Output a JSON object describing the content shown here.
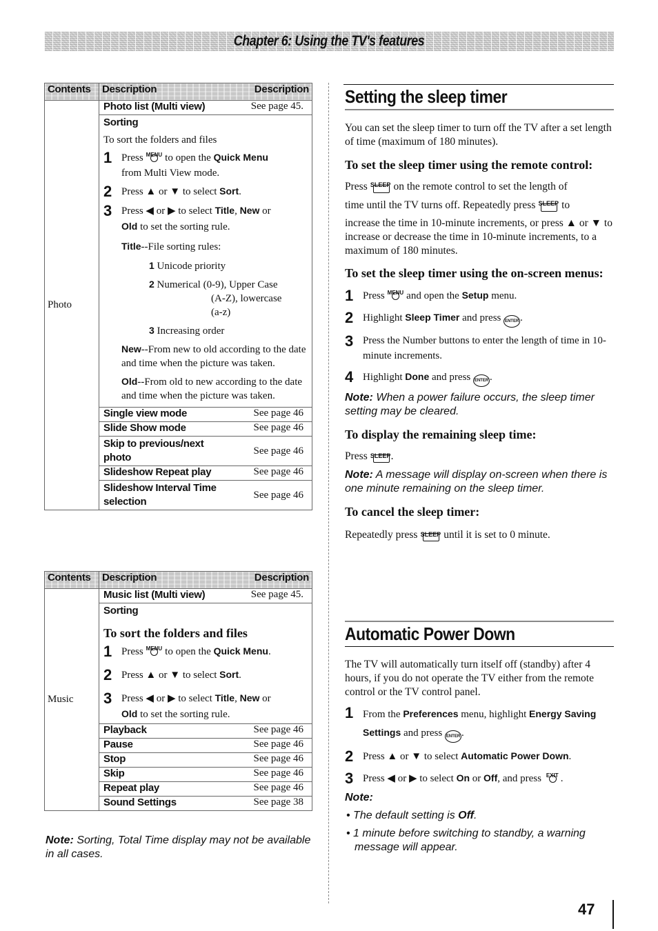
{
  "chapter_title": "Chapter 6: Using the TV's features",
  "page_number": "47",
  "keys": {
    "menu": "MENU",
    "sleep": "SLEEP",
    "enter": "ENTER",
    "exit": "EXIT"
  },
  "photo_table": {
    "headers": [
      "Contents",
      "Description",
      "Description"
    ],
    "category": "Photo",
    "first_row": {
      "item": "Photo list (Multi view)",
      "ref": "See page 45."
    },
    "sorting_label": "Sorting",
    "sorting_intro": "To sort the folders and files",
    "steps": [
      {
        "num": "1",
        "pre": "Press",
        "mid": "to open the",
        "bold": "Quick Menu",
        "post": "from Multi View mode."
      },
      {
        "num": "2",
        "pre": "Press ▲ or ▼ to select",
        "bold": "Sort",
        "post": "."
      },
      {
        "num": "3",
        "pre": "Press ◀ or ▶ to select",
        "bold1": "Title",
        "sep": ",",
        "bold2": "New",
        "or": "or",
        "bold3": "Old",
        "post": "to set the sorting rule."
      }
    ],
    "title_rule": {
      "label": "Title",
      "text": "--File sorting rules:"
    },
    "title_subrules": [
      {
        "num": "1",
        "text": "Unicode priority"
      },
      {
        "num": "2",
        "text": "Numerical (0-9), Upper Case",
        "cont1": "(A-Z), lowercase",
        "cont2": "(a-z)"
      },
      {
        "num": "3",
        "text": "Increasing order"
      }
    ],
    "new_rule": {
      "label": "New",
      "text": "--From new to old according to the date and time when the picture was taken."
    },
    "old_rule": {
      "label": "Old",
      "text": "--From old to new according to the date and time when the picture was taken."
    },
    "rows": [
      {
        "item": "Single view mode",
        "ref": "See page 46"
      },
      {
        "item": "Slide Show mode",
        "ref": "See page 46"
      },
      {
        "item": "Skip to previous/next photo",
        "ref": "See page 46"
      },
      {
        "item": "Slideshow Repeat play",
        "ref": "See page 46"
      },
      {
        "item": "Slideshow Interval Time selection",
        "ref": "See page 46"
      }
    ]
  },
  "music_table": {
    "headers": [
      "Contents",
      "Description",
      "Description"
    ],
    "category": "Music",
    "first_row": {
      "item": "Music list (Multi view)",
      "ref": "See page 45."
    },
    "sorting_label": "Sorting",
    "sorting_heading": "To sort the folders and files",
    "steps": [
      {
        "num": "1",
        "pre": "Press",
        "mid": "to open the",
        "bold": "Quick Menu",
        "post": "."
      },
      {
        "num": "2",
        "pre": "Press ▲ or ▼ to select",
        "bold": "Sort",
        "post": "."
      },
      {
        "num": "3",
        "pre": "Press ◀ or ▶ to select",
        "bold1": "Title",
        "sep": ",",
        "bold2": "New",
        "or": "or",
        "bold3": "Old",
        "post": "to set the sorting rule."
      }
    ],
    "rows": [
      {
        "item": "Playback",
        "ref": "See page 46"
      },
      {
        "item": "Pause",
        "ref": "See page 46"
      },
      {
        "item": "Stop",
        "ref": "See page 46"
      },
      {
        "item": "Skip",
        "ref": "See page 46"
      },
      {
        "item": "Repeat play",
        "ref": "See page 46"
      },
      {
        "item": "Sound Settings",
        "ref": "See page 38"
      }
    ]
  },
  "left_note": {
    "label": "Note:",
    "text": "Sorting, Total Time display may not be available in all cases."
  },
  "sleep_timer": {
    "title": "Setting the sleep timer",
    "intro": "You can set the sleep timer to turn off the TV after a set length of time (maximum of 180 minutes).",
    "remote_heading": "To set the sleep timer using the remote control:",
    "remote_p1a": "Press",
    "remote_p1b": "on the remote control to set the length of",
    "remote_p2a": "time until the TV turns off. Repeatedly press",
    "remote_p2b": "to",
    "remote_p3": "increase the time in 10-minute increments, or press ▲ or ▼ to increase or decrease the time in 10-minute increments, to a maximum of 180 minutes.",
    "menus_heading": "To set the sleep timer using the on-screen menus:",
    "steps": [
      {
        "num": "1",
        "pre": "Press",
        "mid": "and open the",
        "bold": "Setup",
        "post": "menu."
      },
      {
        "num": "2",
        "pre": "Highlight",
        "bold": "Sleep Timer",
        "post": "and press"
      },
      {
        "num": "3",
        "text": "Press the Number buttons to enter the length of time in 10-minute increments."
      },
      {
        "num": "4",
        "pre": "Highlight",
        "bold": "Done",
        "post": "and press"
      }
    ],
    "note1": {
      "label": "Note:",
      "text": "When a power failure occurs, the sleep timer setting may be cleared."
    },
    "display_heading": "To display the remaining sleep time:",
    "display_press": "Press",
    "note2": {
      "label": "Note:",
      "text": "A message will display on-screen when there is one minute remaining on the sleep timer."
    },
    "cancel_heading": "To cancel the sleep timer:",
    "cancel_pre": "Repeatedly press",
    "cancel_post": "until it is set to 0 minute."
  },
  "auto_power": {
    "title": "Automatic Power Down",
    "intro": "The TV will automatically turn itself off (standby) after 4 hours, if you do not operate the TV either from the remote control or the TV control panel.",
    "steps": [
      {
        "num": "1",
        "pre": "From the",
        "bold1": "Preferences",
        "mid": "menu, highlight",
        "bold2": "Energy Saving Settings",
        "post": "and press"
      },
      {
        "num": "2",
        "pre": "Press ▲ or ▼ to select",
        "bold": "Automatic Power Down",
        "post": "."
      },
      {
        "num": "3",
        "pre": "Press ◀ or ▶ to select",
        "bold1": "On",
        "or": "or",
        "bold2": "Off",
        "post": ", and press"
      }
    ],
    "note_label": "Note:",
    "bullets": [
      {
        "pre": "The default setting is",
        "bold": "Off",
        "post": "."
      },
      {
        "text": "1 minute before switching to standby, a warning message will appear."
      }
    ]
  }
}
